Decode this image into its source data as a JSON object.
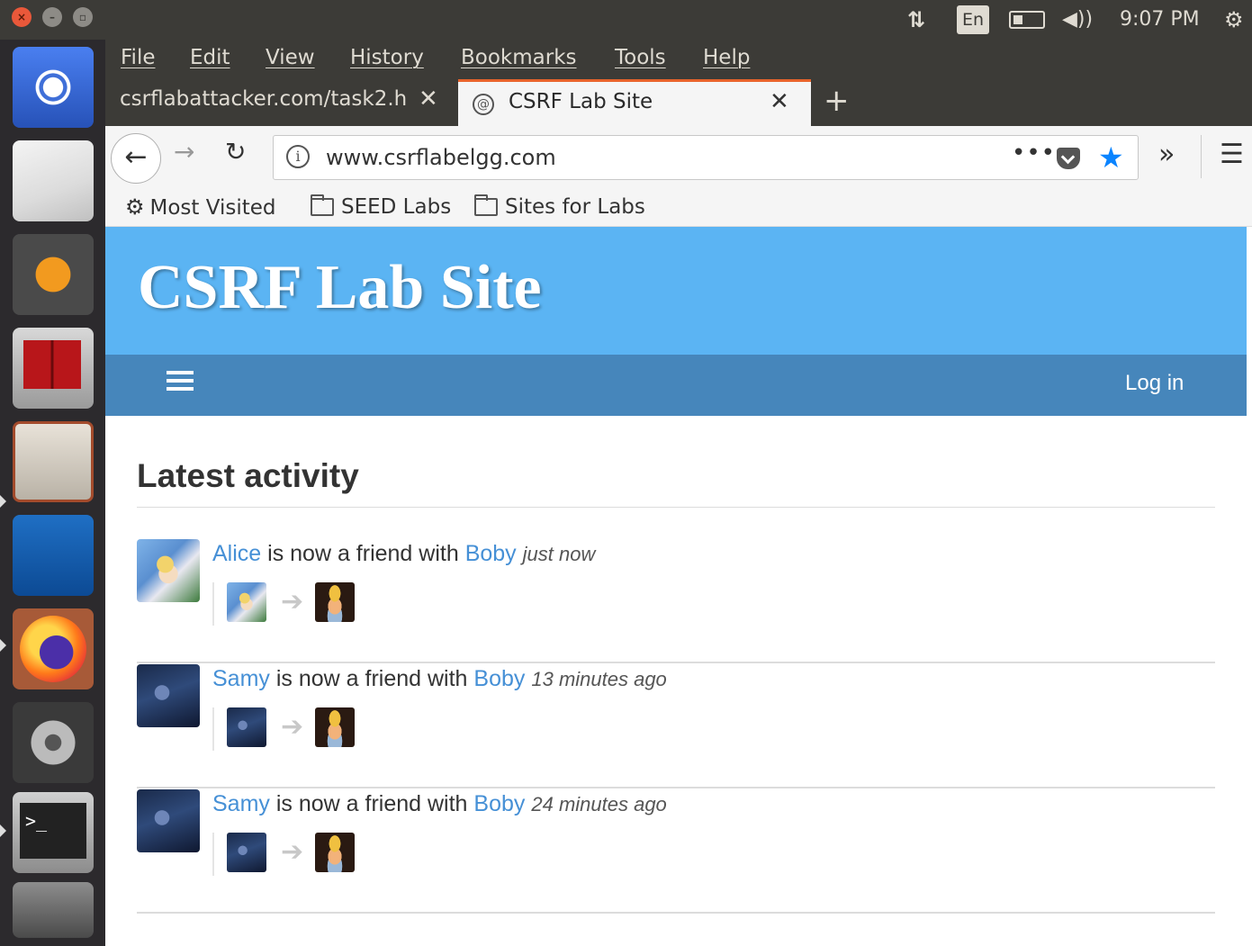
{
  "system_panel": {
    "language": "En",
    "clock": "9:07 PM"
  },
  "launcher": {
    "items": [
      "ubuntu-dash",
      "text-editor",
      "sublime-text",
      "system-monitor",
      "file-manager",
      "wireshark",
      "firefox",
      "system-settings",
      "terminal",
      "trash"
    ]
  },
  "browser": {
    "menu": [
      "File",
      "Edit",
      "View",
      "History",
      "Bookmarks",
      "Tools",
      "Help"
    ],
    "tabs": [
      {
        "title": "csrflabattacker.com/task2.h",
        "active": false
      },
      {
        "title": "CSRF Lab Site",
        "active": true
      }
    ],
    "url": "www.csrflabelgg.com",
    "bookmarks": [
      "Most Visited",
      "SEED Labs",
      "Sites for Labs"
    ]
  },
  "site": {
    "title": "CSRF Lab Site",
    "login_label": "Log in",
    "colors": {
      "header": "#5bb4f3",
      "nav": "#4686bb",
      "link": "#4690d6"
    }
  },
  "activity": {
    "heading": "Latest activity",
    "connector": "is now a friend with",
    "items": [
      {
        "subject": "Alice",
        "object": "Boby",
        "time": "just now"
      },
      {
        "subject": "Samy",
        "object": "Boby",
        "time": "13 minutes ago"
      },
      {
        "subject": "Samy",
        "object": "Boby",
        "time": "24 minutes ago"
      }
    ]
  }
}
